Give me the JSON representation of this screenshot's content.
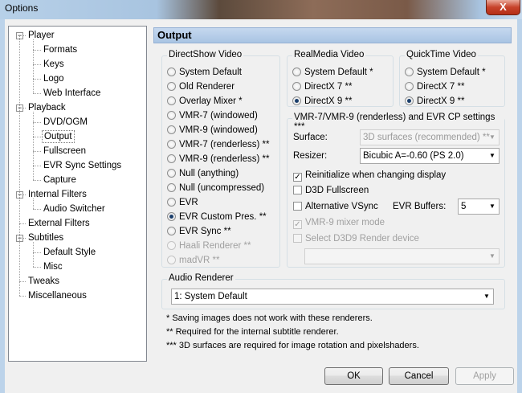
{
  "window": {
    "title": "Options",
    "close_glyph": "X"
  },
  "tree": {
    "items": [
      {
        "label": "Player",
        "level": 0,
        "expander": "−"
      },
      {
        "label": "Formats",
        "level": 1
      },
      {
        "label": "Keys",
        "level": 1
      },
      {
        "label": "Logo",
        "level": 1
      },
      {
        "label": "Web Interface",
        "level": 1
      },
      {
        "label": "Playback",
        "level": 0,
        "expander": "−"
      },
      {
        "label": "DVD/OGM",
        "level": 1
      },
      {
        "label": "Output",
        "level": 1,
        "selected": true
      },
      {
        "label": "Fullscreen",
        "level": 1
      },
      {
        "label": "EVR Sync Settings",
        "level": 1
      },
      {
        "label": "Capture",
        "level": 1
      },
      {
        "label": "Internal Filters",
        "level": 0,
        "expander": "−"
      },
      {
        "label": "Audio Switcher",
        "level": 1
      },
      {
        "label": "External Filters",
        "level": 0
      },
      {
        "label": "Subtitles",
        "level": 0,
        "expander": "−"
      },
      {
        "label": "Default Style",
        "level": 1
      },
      {
        "label": "Misc",
        "level": 1
      },
      {
        "label": "Tweaks",
        "level": 0
      },
      {
        "label": "Miscellaneous",
        "level": 0
      }
    ]
  },
  "panel": {
    "title": "Output"
  },
  "directshow": {
    "legend": "DirectShow Video",
    "options": [
      {
        "label": "System Default",
        "checked": false,
        "disabled": false
      },
      {
        "label": "Old Renderer",
        "checked": false,
        "disabled": false
      },
      {
        "label": "Overlay Mixer *",
        "checked": false,
        "disabled": false
      },
      {
        "label": "VMR-7 (windowed)",
        "checked": false,
        "disabled": false
      },
      {
        "label": "VMR-9 (windowed)",
        "checked": false,
        "disabled": false
      },
      {
        "label": "VMR-7 (renderless) **",
        "checked": false,
        "disabled": false
      },
      {
        "label": "VMR-9 (renderless) **",
        "checked": false,
        "disabled": false
      },
      {
        "label": "Null (anything)",
        "checked": false,
        "disabled": false
      },
      {
        "label": "Null (uncompressed)",
        "checked": false,
        "disabled": false
      },
      {
        "label": "EVR",
        "checked": false,
        "disabled": false
      },
      {
        "label": "EVR Custom Pres. **",
        "checked": true,
        "disabled": false
      },
      {
        "label": "EVR Sync **",
        "checked": false,
        "disabled": false
      },
      {
        "label": "Haali Renderer **",
        "checked": false,
        "disabled": true
      },
      {
        "label": "madVR **",
        "checked": false,
        "disabled": true
      }
    ]
  },
  "realmedia": {
    "legend": "RealMedia Video",
    "options": [
      {
        "label": "System Default *",
        "checked": false
      },
      {
        "label": "DirectX 7 **",
        "checked": false
      },
      {
        "label": "DirectX 9 **",
        "checked": true
      }
    ]
  },
  "quicktime": {
    "legend": "QuickTime Video",
    "options": [
      {
        "label": "System Default *",
        "checked": false
      },
      {
        "label": "DirectX 7 **",
        "checked": false
      },
      {
        "label": "DirectX 9 **",
        "checked": true
      }
    ]
  },
  "vmr_settings": {
    "legend": "VMR-7/VMR-9 (renderless) and EVR CP settings ***",
    "surface_label": "Surface:",
    "surface_value": "3D surfaces (recommended) **",
    "resizer_label": "Resizer:",
    "resizer_value": "Bicubic A=-0.60 (PS 2.0)",
    "reinit_label": "Reinitialize when changing display",
    "reinit_checked": true,
    "d3d_fullscreen_label": "D3D Fullscreen",
    "alt_vsync_label": "Alternative VSync",
    "evr_buffers_label": "EVR Buffers:",
    "evr_buffers_value": "5",
    "vmr9_mixer_label": "VMR-9 mixer mode",
    "vmr9_mixer_checked": true,
    "select_d3d9_label": "Select D3D9 Render device",
    "d3d9_device_value": ""
  },
  "audio": {
    "legend": "Audio Renderer",
    "value": "1: System Default"
  },
  "notes": [
    "* Saving images does not work with these renderers.",
    "** Required for the internal subtitle renderer.",
    "*** 3D surfaces are required for image rotation and pixelshaders."
  ],
  "buttons": {
    "ok": "OK",
    "cancel": "Cancel",
    "apply": "Apply"
  }
}
